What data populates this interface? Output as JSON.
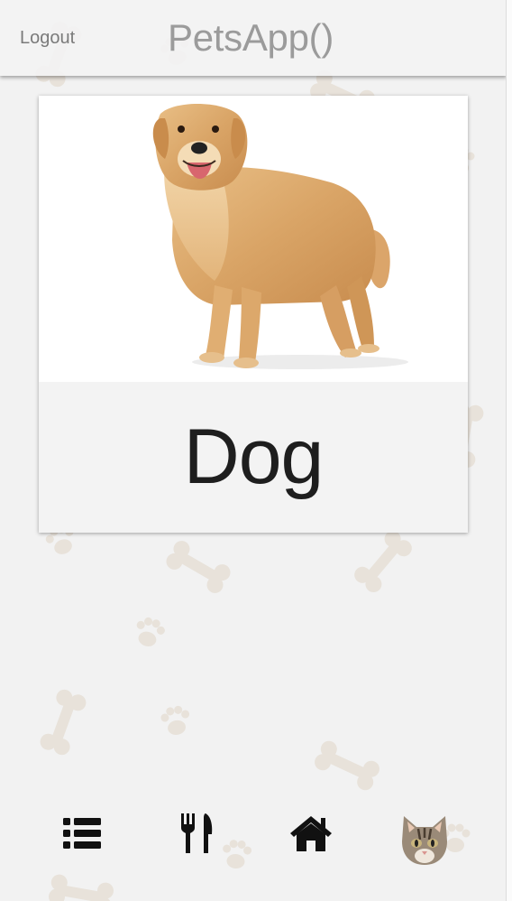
{
  "header": {
    "logout_label": "Logout",
    "title": "PetsApp()"
  },
  "card": {
    "label": "Dog",
    "image_subject": "golden retriever dog photo"
  },
  "bottom_nav": {
    "items": [
      {
        "icon": "list-icon"
      },
      {
        "icon": "fork-knife-icon"
      },
      {
        "icon": "home-icon"
      },
      {
        "icon": "cat-face-icon"
      }
    ]
  },
  "colors": {
    "background": "#f2f2f2",
    "header_text": "#9b9b9b",
    "logout_text": "#7a7a7a",
    "card_label": "#1e1e1e",
    "decor_bone": "#e4ddd2"
  }
}
